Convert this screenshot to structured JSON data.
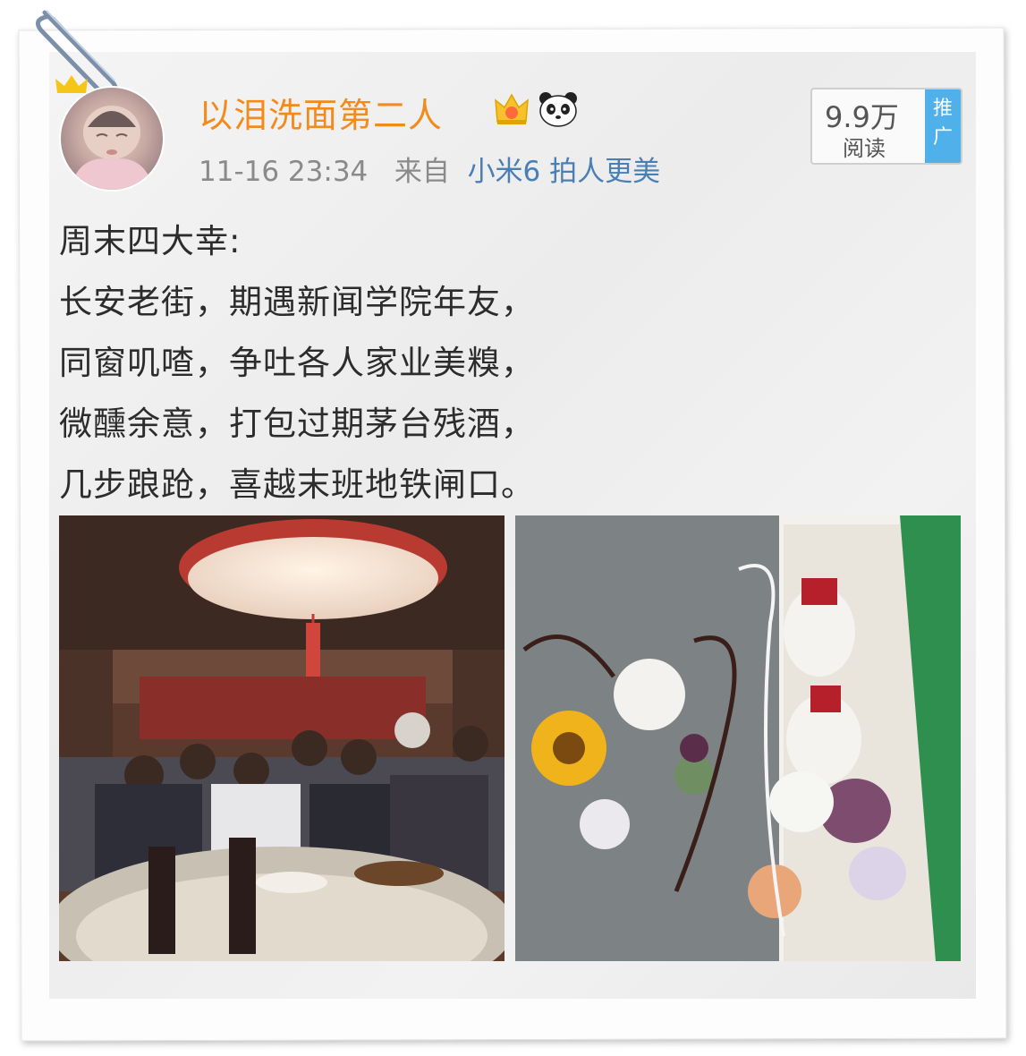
{
  "post": {
    "username": "以泪洗面第二人",
    "timestamp": "11-16 23:34",
    "source_prefix": "来自",
    "device": "小米6 拍人更美",
    "lines": [
      "周末四大幸:",
      "长安老街，期遇新闻学院年友，",
      "同窗叽喳，争吐各人家业美糗，",
      "微醺余意，打包过期茅台残酒，",
      "几步踉跄，喜越末班地铁闸口。"
    ]
  },
  "read_badge": {
    "count": "9.9万",
    "label": "阅读",
    "promo_line1": "推",
    "promo_line2": "广"
  },
  "icons": {
    "clip": "paperclip-icon",
    "crown": "crown-icon",
    "vip": "vip-crown-icon",
    "panda": "panda-icon"
  },
  "colors": {
    "username": "#f28b1b",
    "device_link": "#4a7fb3",
    "promo": "#4fb0ea",
    "meta": "#8a8a8a"
  }
}
